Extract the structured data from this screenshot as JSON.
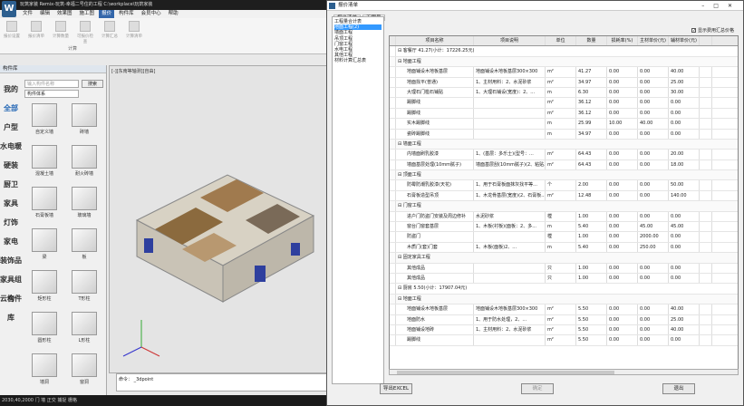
{
  "app": {
    "title": "玩筑家装 Remix-玩筑-幸福二号住的工程  C:\\workplace\\玩筑家装",
    "logo_text": "W",
    "menus": [
      "文件",
      "编辑",
      "效果图",
      "施工图",
      "报价",
      "构件库",
      "会员中心",
      "帮助"
    ],
    "active_menu_index": 4,
    "ribbon_buttons": [
      "报价设置",
      "报价清单",
      "计算数量",
      "可报价检查",
      "计算汇总",
      "计算清单"
    ],
    "ribbon_group": "计算",
    "left_panel_title": "构件库",
    "categories": [
      "我的",
      "全部",
      "户型",
      "水电暖",
      "硬装",
      "厨卫",
      "家具",
      "灯饰",
      "家电",
      "装饰品",
      "家具组合",
      "云构件库"
    ],
    "selected_category_index": 1,
    "search_placeholder": "输入构件名称",
    "search_button": "搜索",
    "filter_select": "构件体系",
    "tiles": [
      "自定义墙",
      "砖墙",
      "混凝土墙",
      "耐火砖墙",
      "石膏板墙",
      "玻璃墙",
      "梁",
      "板",
      "矩形柱",
      "T形柱",
      "圆形柱",
      "L形柱",
      "墙洞",
      "窗洞"
    ],
    "viewport_label": "[-][东南等轴测][自由]",
    "command_label": "命令：",
    "command_text": "_3dpoint",
    "status_text": "2030,40,2000  门 墙   正交 捕捉 栅格"
  },
  "dialog": {
    "title": "报价清单",
    "tabs": [
      "报价清单",
      "工程量"
    ],
    "tree": [
      "工程量合计表",
      "地面工程(2)",
      "墙面工程",
      "吊顶工程",
      "门窗工程",
      "水电工程",
      "其他工程",
      "材料计算汇总表"
    ],
    "tree_selected_index": 1,
    "show_summary_label": "显示费用汇总价格",
    "show_summary_checked": true,
    "columns": [
      "项目名称",
      "项目说明",
      "单位",
      "数量",
      "损耗率(%)",
      "主材单价(元)",
      "辅材单价(元)"
    ],
    "rows": [
      {
        "type": "space",
        "name": "⊟ 客餐厅 41.27(小计：17226.25元)"
      },
      {
        "type": "cat",
        "name": "⊟ 地面工程"
      },
      {
        "type": "item",
        "name": "地面铺设木地板基层",
        "desc": "地面铺设木地板基层300×300",
        "unit": "m²",
        "qty": "41.27",
        "loss": "0.00",
        "mat": "0.00",
        "aux": "40.00"
      },
      {
        "type": "item",
        "name": "地面找平(普通)",
        "desc": "1、主材用料：2、水泥砂浆",
        "unit": "m²",
        "qty": "34.97",
        "loss": "0.00",
        "mat": "0.00",
        "aux": "25.00"
      },
      {
        "type": "item",
        "name": "大理石门槛石铺贴",
        "desc": "1、大理石铺设(宽度)：2、...",
        "unit": "m",
        "qty": "6.30",
        "loss": "0.00",
        "mat": "0.00",
        "aux": "30.00"
      },
      {
        "type": "item",
        "name": "踢脚线",
        "desc": "",
        "unit": "m²",
        "qty": "36.12",
        "loss": "0.00",
        "mat": "0.00",
        "aux": "0.00"
      },
      {
        "type": "item",
        "name": "踢脚线",
        "desc": "",
        "unit": "m²",
        "qty": "36.12",
        "loss": "0.00",
        "mat": "0.00",
        "aux": "0.00"
      },
      {
        "type": "item",
        "name": "实木踢脚线",
        "desc": "",
        "unit": "m",
        "qty": "25.99",
        "loss": "10.00",
        "mat": "40.00",
        "aux": "0.00"
      },
      {
        "type": "item",
        "name": "瓷砖踢脚线",
        "desc": "",
        "unit": "m",
        "qty": "34.97",
        "loss": "0.00",
        "mat": "0.00",
        "aux": "0.00"
      },
      {
        "type": "cat",
        "name": "⊟ 墙面工程"
      },
      {
        "type": "item",
        "name": "内墙面刷乳胶漆",
        "desc": "1、(基层：多乐士)(型号：...",
        "unit": "m²",
        "qty": "64.43",
        "loss": "0.00",
        "mat": "0.00",
        "aux": "20.00"
      },
      {
        "type": "item",
        "name": "墙面基层处理(10mm腻子)",
        "desc": "墙面基层刮(10mm腻子)(2、粘贴...",
        "unit": "m²",
        "qty": "64.43",
        "loss": "0.00",
        "mat": "0.00",
        "aux": "18.00"
      },
      {
        "type": "cat",
        "name": "⊟ 顶面工程"
      },
      {
        "type": "item",
        "name": "防霉防潮乳胶漆(天花)",
        "desc": "1、用于石膏板面抹灰找平等...",
        "unit": "个",
        "qty": "2.00",
        "loss": "0.00",
        "mat": "0.00",
        "aux": "50.00"
      },
      {
        "type": "item",
        "name": "石膏板造型吊顶",
        "desc": "1、木龙骨基层(宽度)(2、石膏板...",
        "unit": "m²",
        "qty": "12.48",
        "loss": "0.00",
        "mat": "0.00",
        "aux": "140.00"
      },
      {
        "type": "cat",
        "name": "⊟ 门窗工程"
      },
      {
        "type": "item",
        "name": "进户门防盗门安装及周边修补",
        "desc": "水泥砂浆",
        "unit": "樘",
        "qty": "1.00",
        "loss": "0.00",
        "mat": "0.00",
        "aux": "0.00"
      },
      {
        "type": "item",
        "name": "窗台门窗套基层",
        "desc": "1、木板(衬板)(面板：2、多...",
        "unit": "m",
        "qty": "5.40",
        "loss": "0.00",
        "mat": "45.00",
        "aux": "45.00"
      },
      {
        "type": "item",
        "name": "防盗门",
        "desc": "",
        "unit": "樘",
        "qty": "1.00",
        "loss": "0.00",
        "mat": "2000.00",
        "aux": "0.00"
      },
      {
        "type": "item",
        "name": "木质门(套)门套",
        "desc": "1、木板(面板)2、...",
        "unit": "m",
        "qty": "5.40",
        "loss": "0.00",
        "mat": "250.00",
        "aux": "0.00"
      },
      {
        "type": "cat",
        "name": "⊟ 固定家具工程"
      },
      {
        "type": "item",
        "name": "其他成品",
        "desc": "",
        "unit": "只",
        "qty": "1.00",
        "loss": "0.00",
        "mat": "0.00",
        "aux": "0.00"
      },
      {
        "type": "item",
        "name": "其他成品",
        "desc": "",
        "unit": "只",
        "qty": "1.00",
        "loss": "0.00",
        "mat": "0.00",
        "aux": "0.00"
      },
      {
        "type": "space",
        "name": "⊟ 厨房 5.50(小计：17907.04元)"
      },
      {
        "type": "cat",
        "name": "⊟ 地面工程"
      },
      {
        "type": "item",
        "name": "地面铺设木地板基层",
        "desc": "地面铺设木地板基层300×300",
        "unit": "m²",
        "qty": "5.50",
        "loss": "0.00",
        "mat": "0.00",
        "aux": "40.00"
      },
      {
        "type": "item",
        "name": "地面防水",
        "desc": "1、用于防水处理，2、...",
        "unit": "m²",
        "qty": "5.50",
        "loss": "0.00",
        "mat": "0.00",
        "aux": "25.00"
      },
      {
        "type": "item",
        "name": "地面铺设地砖",
        "desc": "1、主材用料：2、水泥砂浆",
        "unit": "m²",
        "qty": "5.50",
        "loss": "0.00",
        "mat": "0.00",
        "aux": "40.00"
      },
      {
        "type": "item",
        "name": "踢脚线",
        "desc": "",
        "unit": "m²",
        "qty": "5.50",
        "loss": "0.00",
        "mat": "0.00",
        "aux": "0.00"
      }
    ],
    "buttons": [
      "导出EXCEL",
      "确定",
      "退出"
    ]
  }
}
